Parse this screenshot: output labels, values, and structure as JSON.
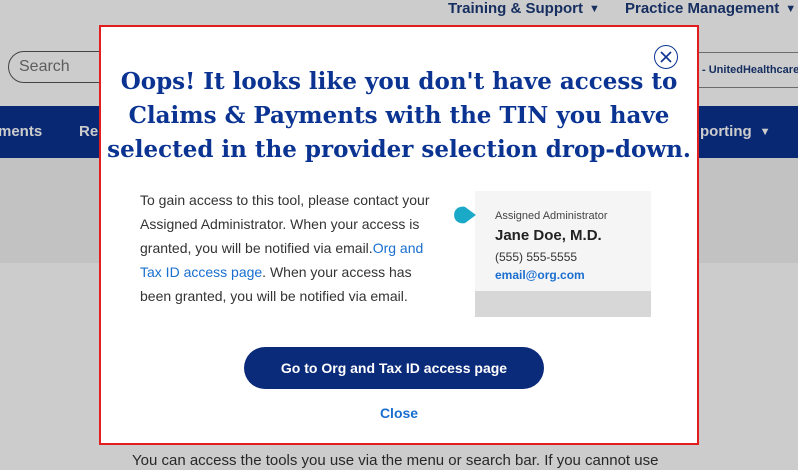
{
  "topnav": {
    "training_support": "Training & Support",
    "practice_management": "Practice Management"
  },
  "search": {
    "placeholder": "Search"
  },
  "provider_select": {
    "value": "- UnitedHealthcare"
  },
  "mainnav": {
    "item_1": "ments",
    "item_2": "Re",
    "item_3": "porting"
  },
  "page": {
    "info_text": "You can access the tools you use via the menu or search bar. If you cannot use"
  },
  "modal": {
    "title": "Oops! It looks like you don't have access to Claims & Payments with the TIN you have selected in the provider selection drop-down.",
    "body_1": "To gain access to this tool, please contact your Assigned Administrator. When your access is granted, you will be notified via email.",
    "body_link": "Org and Tax ID access page",
    "body_2": ". When your access has been granted, you will be notified via email.",
    "admin_card": {
      "role": "Assigned Administrator",
      "name": "Jane Doe, M.D.",
      "phone": "(555) 555-5555",
      "email": "email@org.com"
    },
    "primary_button": "Go to Org and Tax ID access page",
    "close_link": "Close"
  },
  "colors": {
    "brand_blue": "#0a3392",
    "button_navy": "#0a2a7a",
    "link_blue": "#196ecf",
    "pointer_teal": "#1aa9c7",
    "modal_border": "#e11d1d"
  },
  "icons": [
    "chevron-down-icon",
    "close-icon",
    "pointer-icon"
  ]
}
